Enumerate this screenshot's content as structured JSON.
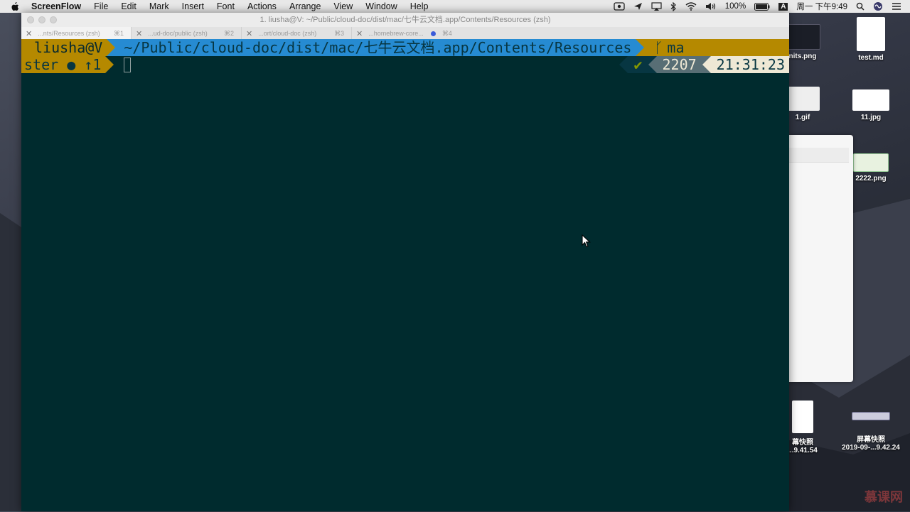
{
  "menubar": {
    "app_name": "ScreenFlow",
    "items": [
      "File",
      "Edit",
      "Mark",
      "Insert",
      "Font",
      "Actions",
      "Arrange",
      "View",
      "Window",
      "Help"
    ],
    "battery": "100%",
    "input_source": "A",
    "clock": "周一 下午9:49"
  },
  "window": {
    "title": "1. liusha@V: ~/Public/cloud-doc/dist/mac/七牛云文档.app/Contents/Resources (zsh)",
    "tabs": [
      {
        "label": "...nts/Resources (zsh)",
        "key": "⌘1"
      },
      {
        "label": "...ud-doc/public (zsh)",
        "key": "⌘2"
      },
      {
        "label": "...ort/cloud-doc (zsh)",
        "key": "⌘3"
      },
      {
        "label": "...homebrew-core...",
        "key": "⌘4"
      }
    ]
  },
  "terminal": {
    "user": "liusha@V",
    "path": "~/Public/cloud-doc/dist/mac/七牛云文档.app/Contents/Resources",
    "branch_head": "ma",
    "branch_tail": "ster ● ↑1",
    "status_check": "✔",
    "history_number": "2207",
    "time": "21:31:23"
  },
  "desktop": {
    "icons": [
      {
        "label": "nits.png"
      },
      {
        "label": "test.md"
      },
      {
        "label": "1.gif"
      },
      {
        "label": "11.jpg"
      },
      {
        "label": "2222.png"
      },
      {
        "label": "幕快照",
        "sub": "...9.41.54"
      },
      {
        "label": "屏幕快照",
        "sub": "2019-09-...9.42.24"
      }
    ],
    "watermark": "慕课网"
  },
  "colors": {
    "terminal_bg": "#002b2e",
    "segment_yellow": "#b58900",
    "segment_blue": "#268bd2",
    "check_green": "#859900"
  }
}
